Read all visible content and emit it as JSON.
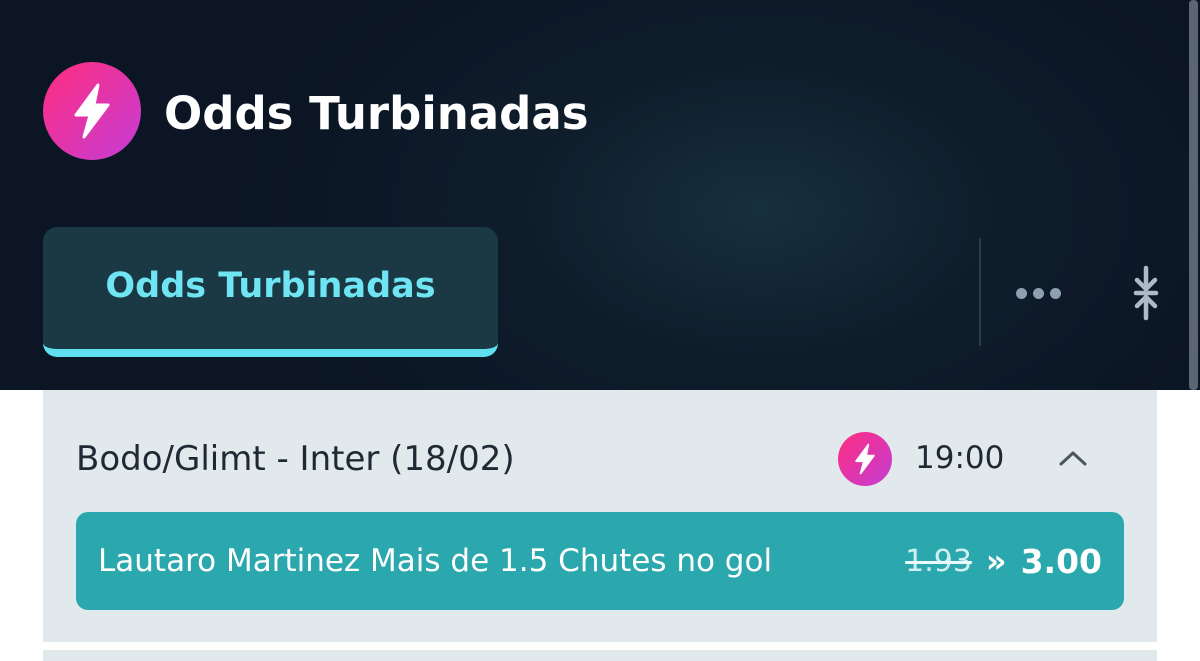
{
  "header": {
    "title": "Odds Turbinadas",
    "brand_icon": "lightning-bolt-icon",
    "accent_color": "#5fe0f0",
    "brand_gradient": [
      "#ff2d7f",
      "#c43dd6"
    ]
  },
  "tabs": [
    {
      "label": "Odds Turbinadas",
      "active": true
    }
  ],
  "toolbar": {
    "more_icon": "more-horizontal-icon",
    "collapse_icon": "collapse-vertical-icon"
  },
  "event": {
    "title": "Bodo/Glimt - Inter (18/02)",
    "time": "19:00",
    "boost_icon": "lightning-bolt-icon",
    "expanded": true,
    "bets": [
      {
        "label": "Lautaro Martinez Mais de 1.5 Chutes no gol",
        "old_odd": "1.93",
        "separator": "»",
        "new_odd": "3.00",
        "color": "#2aa8ad"
      }
    ]
  }
}
